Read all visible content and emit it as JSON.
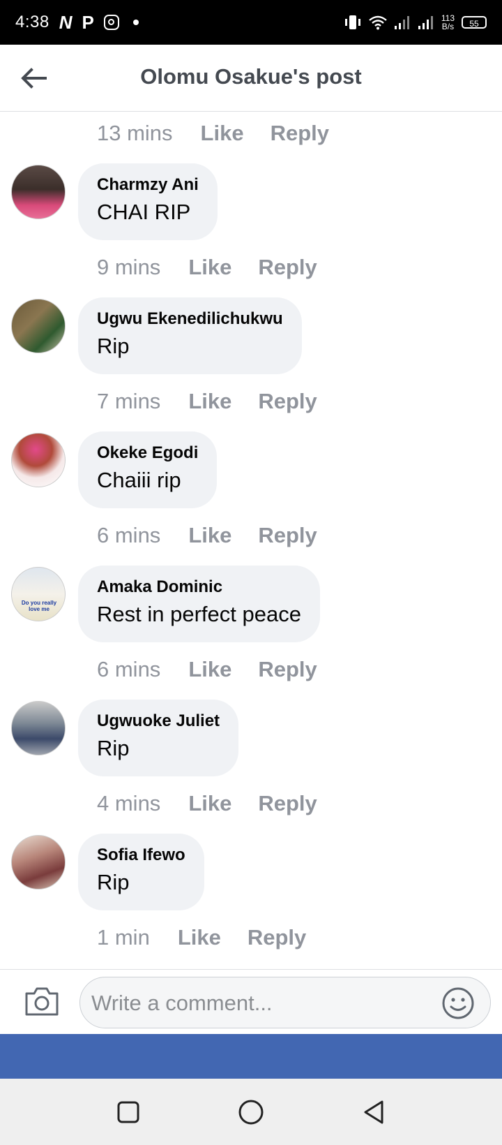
{
  "status_bar": {
    "time": "4:38",
    "icons": [
      "netflix-n-icon",
      "p-icon",
      "instagram-icon",
      "dot-icon",
      "vibrate-icon",
      "wifi-icon",
      "signal-icon",
      "signal-icon",
      "battery-icon"
    ],
    "speed_value": "113",
    "speed_unit": "B/s",
    "battery": "55"
  },
  "header": {
    "title": "Olomu Osakue's post",
    "back_icon": "arrow-left-icon"
  },
  "colors": {
    "bubble_bg": "#f0f2f5",
    "meta_text": "#90949c",
    "brand_blue": "#4267b2",
    "header_title": "#444950"
  },
  "top_meta": {
    "time": "13 mins",
    "like": "Like",
    "reply": "Reply"
  },
  "comments": [
    {
      "author": "Charmzy Ani",
      "text": "CHAI RIP",
      "time": "9 mins",
      "like": "Like",
      "reply": "Reply"
    },
    {
      "author": "Ugwu Ekenedilichukwu",
      "text": "Rip",
      "time": "7 mins",
      "like": "Like",
      "reply": "Reply"
    },
    {
      "author": "Okeke Egodi",
      "text": "Chaiii rip",
      "time": "6 mins",
      "like": "Like",
      "reply": "Reply"
    },
    {
      "author": "Amaka Dominic",
      "text": "Rest in perfect peace",
      "time": "6 mins",
      "like": "Like",
      "reply": "Reply",
      "avatar_text": "Do you really love me"
    },
    {
      "author": "Ugwuoke Juliet",
      "text": "Rip",
      "time": "4 mins",
      "like": "Like",
      "reply": "Reply"
    },
    {
      "author": "Sofia Ifewo",
      "text": "Rip",
      "time": "1 min",
      "like": "Like",
      "reply": "Reply"
    }
  ],
  "composer": {
    "placeholder": "Write a comment...",
    "camera_icon": "camera-icon",
    "emoji_icon": "smiley-icon"
  },
  "nav_bar": {
    "buttons": [
      "recents-square-icon",
      "home-circle-icon",
      "back-triangle-icon"
    ]
  }
}
